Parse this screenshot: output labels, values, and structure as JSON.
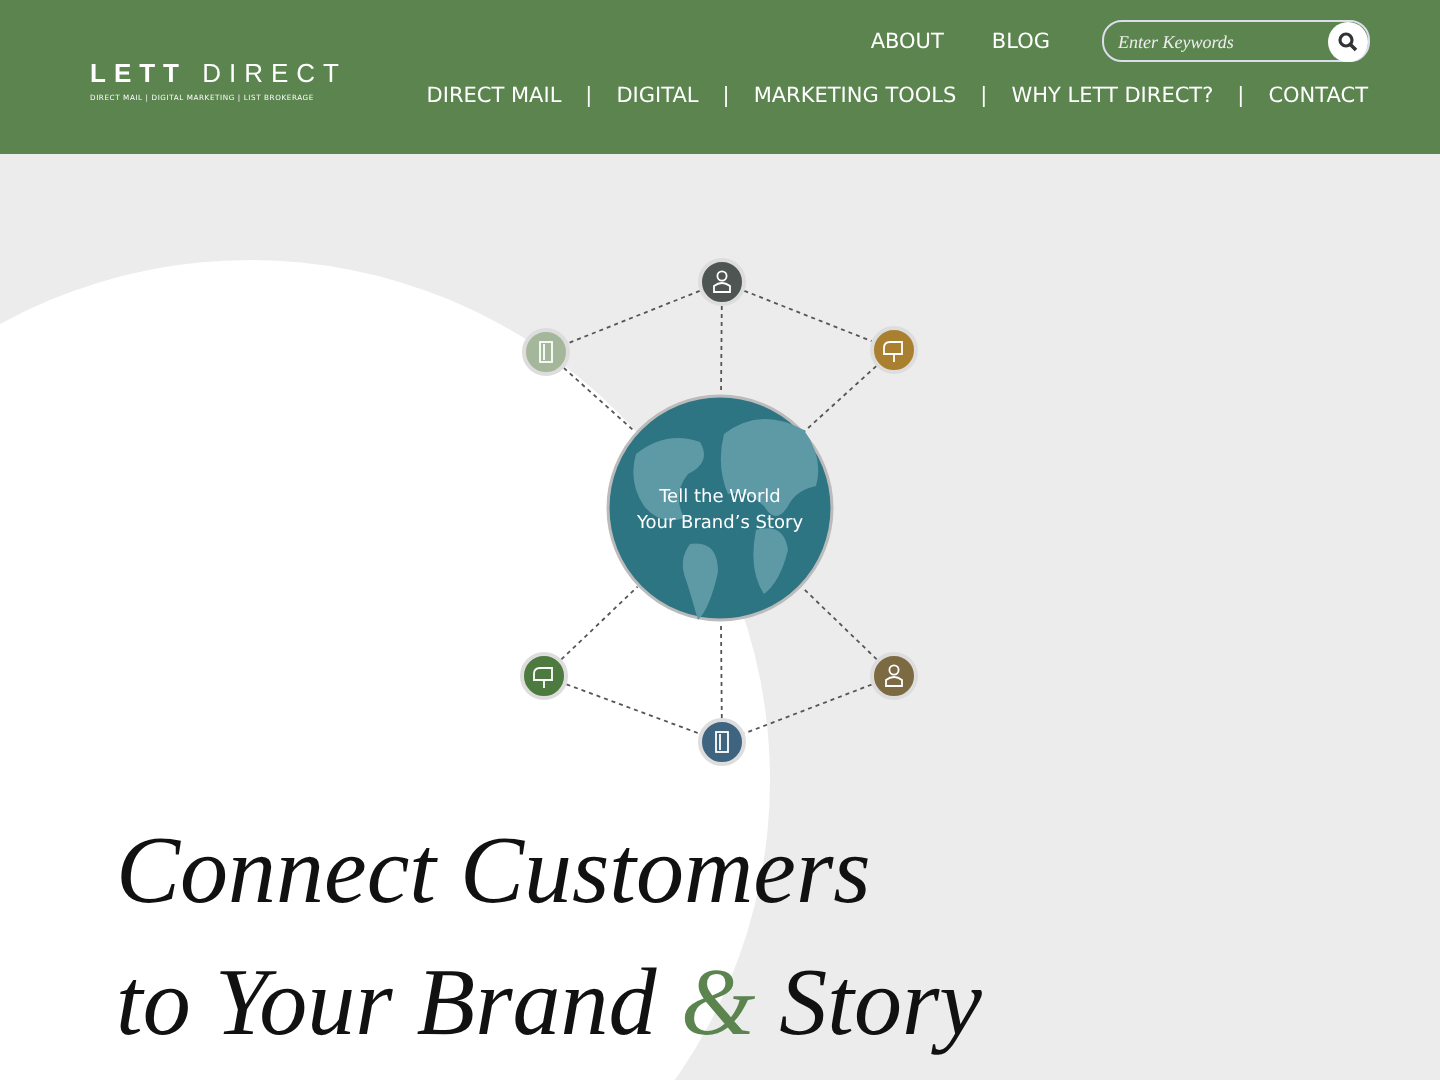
{
  "header": {
    "logo": {
      "bold": "LETT",
      "light": "DIRECT",
      "tagline": "DIRECT MAIL | DIGITAL MARKETING | LIST BROKERAGE"
    },
    "top_links": [
      "ABOUT",
      "BLOG"
    ],
    "search": {
      "placeholder": "Enter Keywords"
    },
    "nav": {
      "items": [
        "DIRECT MAIL",
        "DIGITAL",
        "MARKETING TOOLS",
        "WHY LETT DIRECT?",
        "CONTACT"
      ],
      "separators": [
        "|",
        "|",
        "|",
        "|"
      ]
    }
  },
  "diagram": {
    "caption": [
      "Tell the World",
      "Your Brand’s Story"
    ],
    "nodes": [
      {
        "kind": "person",
        "color": "#4f5553"
      },
      {
        "kind": "door",
        "color": "#a5b79a"
      },
      {
        "kind": "mailbox",
        "color": "#a9802f"
      },
      {
        "kind": "mailbox",
        "color": "#4d7a3e"
      },
      {
        "kind": "door",
        "color": "#3f6480"
      },
      {
        "kind": "person",
        "color": "#7b6a42"
      }
    ]
  },
  "headline": [
    [
      {
        "text": "Connect Customers",
        "accent": false
      }
    ],
    [
      {
        "text": "to Your Brand ",
        "accent": false
      },
      {
        "text": "&",
        "accent": true
      },
      {
        "text": " Story",
        "accent": false
      }
    ]
  ]
}
